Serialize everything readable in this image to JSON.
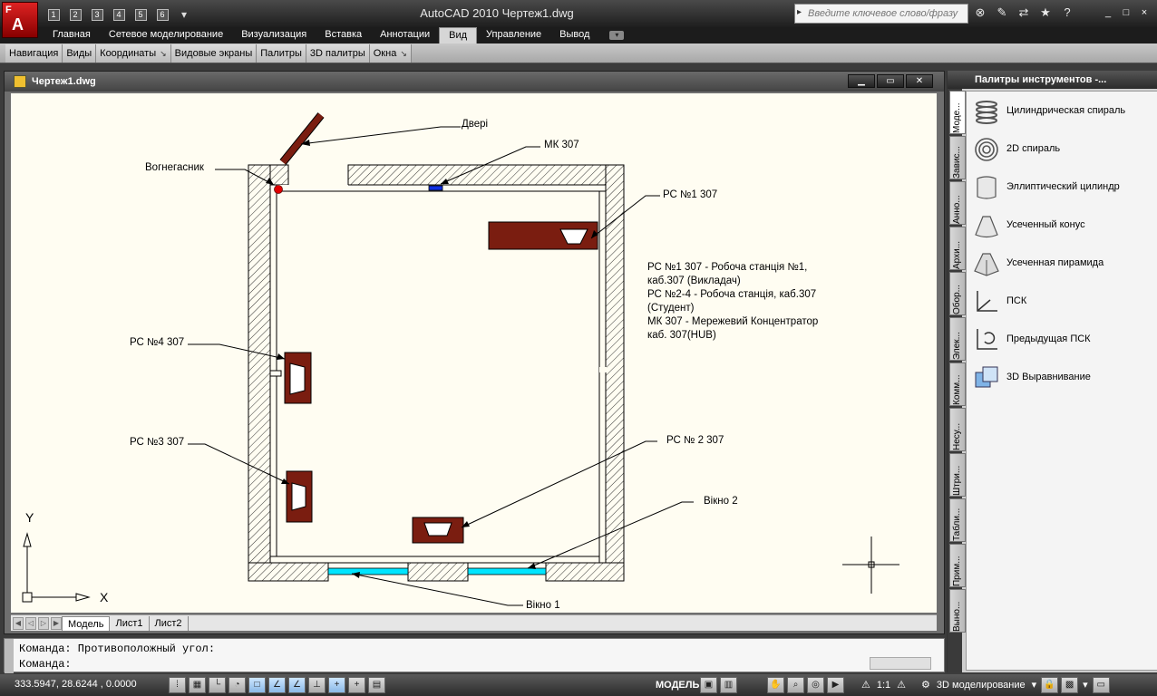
{
  "titlebar": {
    "logo_letter": "F",
    "logo_mark": "A",
    "qat": [
      "1",
      "2",
      "3",
      "4",
      "5",
      "6"
    ],
    "title": "AutoCAD 2010    Чертеж1.dwg",
    "search_placeholder": "Введите ключевое слово/фразу",
    "icons": [
      "binoculars-icon",
      "wrench-icon",
      "exchange-icon",
      "star-icon",
      "help-icon"
    ],
    "window_buttons": [
      "_",
      "□",
      "×"
    ]
  },
  "ribbon": {
    "tabs": [
      "Главная",
      "Сетевое моделирование",
      "Визуализация",
      "Вставка",
      "Аннотации",
      "Вид",
      "Управление",
      "Вывод"
    ],
    "active_tab": "Вид",
    "panels": [
      "Навигация",
      "Виды",
      "Координаты",
      "Видовые экраны",
      "Палитры",
      "3D палитры",
      "Окна"
    ]
  },
  "drawing": {
    "window_title": "Чертеж1.dwg",
    "labels": {
      "doors": "Двері",
      "extinguisher": "Вогнегасник",
      "hub": "МК 307",
      "pc1": "РС №1 307",
      "pc4": "РС №4 307",
      "pc3": "РС №3 307",
      "pc2": "РС № 2 307",
      "window2": "Вікно 2",
      "window1": "Вікно 1",
      "axis_x": "X",
      "axis_y": "Y"
    },
    "legend": [
      "РС №1 307 - Робоча станція №1,",
      "каб.307 (Викладач)",
      "РС №2-4 - Робоча станція, каб.307",
      "(Студент)",
      "МК 307 - Мережевий Концентратор",
      "каб. 307(HUB)"
    ],
    "layout_tabs": [
      "Модель",
      "Лист1",
      "Лист2"
    ],
    "active_layout": "Модель"
  },
  "command": {
    "line1": "Команда: Противоположный угол:",
    "line2": "Команда:"
  },
  "status": {
    "coords": "333.5947, 28.6244 , 0.0000",
    "model": "МОДЕЛЬ",
    "scale": "1:1",
    "workspace": "3D моделирование"
  },
  "palette": {
    "title": "Палитры инструментов -...",
    "tabs": [
      "Моде...",
      "Завис...",
      "Анно...",
      "Архи...",
      "Обор...",
      "Элек...",
      "Комм...",
      "Несу...",
      "Штри...",
      "Табли...",
      "Прим...",
      "Выно..."
    ],
    "items": [
      {
        "label": "Цилиндрическая спираль",
        "icon": "helix-icon"
      },
      {
        "label": "2D спираль",
        "icon": "spiral-icon"
      },
      {
        "label": "Эллиптический цилиндр",
        "icon": "elliptic-cylinder-icon"
      },
      {
        "label": "Усеченный конус",
        "icon": "truncated-cone-icon"
      },
      {
        "label": "Усеченная пирамида",
        "icon": "truncated-pyramid-icon"
      },
      {
        "label": "ПСК",
        "icon": "ucs-icon"
      },
      {
        "label": "Предыдущая ПСК",
        "icon": "ucs-previous-icon"
      },
      {
        "label": "3D Выравнивание",
        "icon": "3d-align-icon"
      }
    ]
  }
}
